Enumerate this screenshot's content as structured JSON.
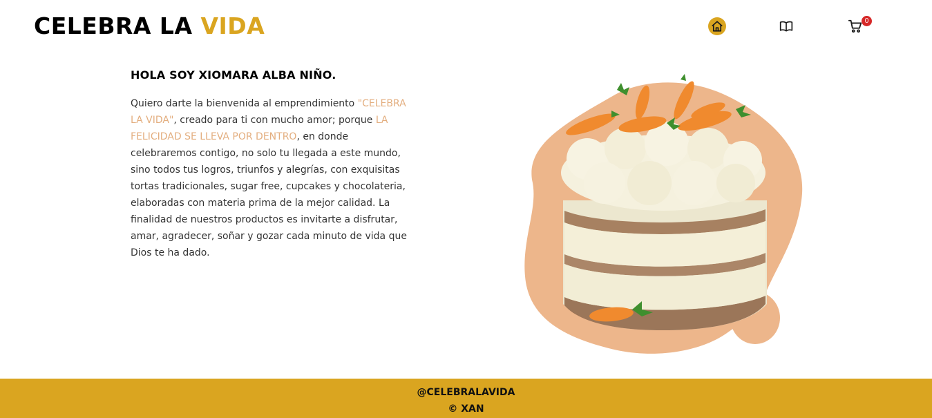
{
  "header": {
    "logo_main": "CELEBRA LA ",
    "logo_accent": "VIDA",
    "nav": [
      {
        "name": "home",
        "icon": "home-icon"
      },
      {
        "name": "book",
        "icon": "book-icon"
      },
      {
        "name": "cart",
        "icon": "cart-icon",
        "badge": "0"
      }
    ]
  },
  "intro": {
    "title": "HOLA SOY XIOMARA ALBA NIÑO.",
    "p1": "Quiero darte la bienvenida al emprendimiento ",
    "hl1": "\"CELEBRA LA VIDA\"",
    "p2": ", creado para ti con mucho amor; porque ",
    "hl2": "LA FELICIDAD SE LLEVA POR DENTRO",
    "p3": ", en donde celebraremos contigo, no solo tu llegada a este mundo, sino todos tus logros, triunfos y alegrías, con exquisitas tortas tradicionales, sugar free, cupcakes y chocolateria, elaboradas con materia prima de la mejor calidad. La finalidad de nuestros productos es invitarte a disfrutar, amar, agradecer, soñar y gozar cada minuto de vida que Dios te ha dado."
  },
  "hero": {
    "image": "carrot-cake-photo"
  },
  "footer": {
    "handle": "@CELEBRALAVIDA",
    "copyright": "© XAN"
  },
  "colors": {
    "accent": "#DAA520",
    "highlight_text": "#E3AE7F",
    "blob": "#EDB68B",
    "badge": "#d62828"
  }
}
